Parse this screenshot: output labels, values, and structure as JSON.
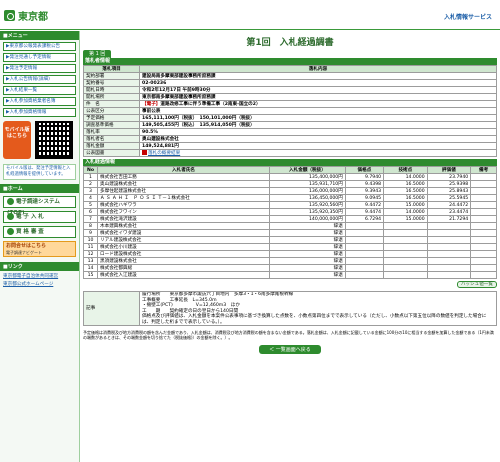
{
  "header": {
    "logo": "東京都",
    "service": "入札情報サービス"
  },
  "sidebar": {
    "menu_head": "■メニュー",
    "items": [
      "▶東京都公報発表課税公告",
      "▶発注見通し予定情報",
      "▶発注予定情報",
      "▶入札公告情報(詳細)",
      "▶入札結果一覧",
      "▶入札参加資格業者名簿",
      "▶入札参加資格情報"
    ],
    "mobile_label": "モバイル版",
    "mobile_sub": "はこちら",
    "mobile_note": "モバイル版は、発注予定情報と入札経過情報を提供しています。",
    "head2": "■ホーム",
    "big_buttons": [
      "電子調達システム(TOP)",
      "電 子 入 札",
      "資 格 審 査"
    ],
    "orange_title": "お問合せはこちら",
    "orange_sub": "電子調達ナビゲート",
    "links_head": "■リンク",
    "links": [
      "東京都電子自治体共同運営",
      "東京都公式ホームページ"
    ]
  },
  "main": {
    "title": "第1回　入札経過調書",
    "tab": "第 1 回",
    "section1": "落札者情報",
    "info_header": [
      "落札項目",
      "落札内容"
    ],
    "info_rows": [
      {
        "label": "契約部署",
        "value": "建設局南多摩東部建設事務所庶務課"
      },
      {
        "label": "契約番号",
        "value": "02-00236"
      },
      {
        "label": "開札日時",
        "value": "令和2年12月17日 午前9時30分"
      },
      {
        "label": "開札場所",
        "value": "東京都南多摩東部建設事務所庶務課"
      },
      {
        "label": "件　名",
        "tag": "【電子】",
        "value": "道路改修工事に伴う準備工事（2南東-国立の2）"
      },
      {
        "label": "公表区分",
        "value": "事前公表"
      },
      {
        "label": "予定価格",
        "value": "165,111,100円（税抜）　150,101,000円（税抜）"
      },
      {
        "label": "調査基準価格",
        "value": "149,505,455円（税込）　135,914,050円（税抜）"
      },
      {
        "label": "落札率",
        "value": "90.5%"
      },
      {
        "label": "落札者名",
        "value": "奥山建設株式会社"
      },
      {
        "label": "落札金額",
        "value": "149,524,881円"
      },
      {
        "label": "公表図書",
        "value": "落札の概要結果"
      }
    ],
    "section2": "入札経過情報",
    "bid_header": [
      "No",
      "入札者氏名",
      "入札金額（税抜）",
      "価格点",
      "技術点",
      "評価値",
      "備考"
    ],
    "bids": [
      [
        "1",
        "株式会社吉田工務",
        "135,400,000円",
        "9.7940",
        "14.0000",
        "23.7940",
        ""
      ],
      [
        "2",
        "奥山建設株式会社",
        "135,931,710円",
        "9.4398",
        "16.5000",
        "25.9398",
        ""
      ],
      [
        "3",
        "多摩住起建設株式会社",
        "136,000,000円",
        "9.3943",
        "16.5000",
        "25.8943",
        ""
      ],
      [
        "4",
        "Ａ Ｓ Ａ Ｈ Ｉ　Ｐ Ｏ Ｓ Ｉ Ｔ－１株式会社",
        "136,450,000円",
        "9.0945",
        "16.5000",
        "25.5945",
        ""
      ],
      [
        "5",
        "株式会社ハギワラ",
        "135,920,560円",
        "9.4472",
        "15.0000",
        "24.4472",
        ""
      ],
      [
        "6",
        "株式会社フワイン",
        "135,920,350円",
        "9.4474",
        "14.0000",
        "23.4474",
        ""
      ],
      [
        "7",
        "株式会社滝沢建設",
        "140,000,000円",
        "6.7294",
        "15.0000",
        "21.7294",
        ""
      ],
      [
        "8",
        "木本建興株式会社",
        "辞退",
        "",
        "",
        "",
        ""
      ],
      [
        "9",
        "株式会社イワダ建設",
        "辞退",
        "",
        "",
        "",
        ""
      ],
      [
        "10",
        "リアル建設株式会社",
        "辞退",
        "",
        "",
        "",
        ""
      ],
      [
        "11",
        "株式会社小川建設",
        "辞退",
        "",
        "",
        "",
        ""
      ],
      [
        "12",
        "ロード建設株式会社",
        "辞退",
        "",
        "",
        "",
        ""
      ],
      [
        "13",
        "黒須建設株式会社",
        "辞退",
        "",
        "",
        "",
        ""
      ],
      [
        "14",
        "株式会社都興総",
        "辞退",
        "",
        "",
        "",
        ""
      ],
      [
        "15",
        "株式会社入江建設",
        "辞退",
        "",
        "",
        "",
        ""
      ]
    ],
    "note_button": "ハッシュ値一覧",
    "remarks_label": "記事",
    "remarks_lines": [
      "履行場所　　東京都多摩市諏訪六丁目地内　多摩3・1・6南多摩尾根幹線",
      "工事概要　　工事延長　L=345.0m",
      "・擁壁工(PCT)　　　　　V=12,460m3　ほか",
      "工　　期　　契約確定の日の翌日から140日間",
      "価格点及び評価値は、入札金額を本案件公表事項に基づき換算した点数を、小数点第四位までで表示している（ただし、小数点以下第五位以降の数値を判定した場合には、判定した桁までで表示している。）。"
    ],
    "footnote": "予定価格は消費税及び地方消費税の額を含んだ金額であり、入札金額は、消費税及び地方消費税の額を含まない金額である。落札金額は、入札金額に記載している金額に100分の10に相当する金額を加算した金額である（1円未満の端数があるときは、その端数金額を切り捨てた（税抜価格)）の金額を除く。）。",
    "back_button": "＜ 一覧画面へ戻る"
  }
}
